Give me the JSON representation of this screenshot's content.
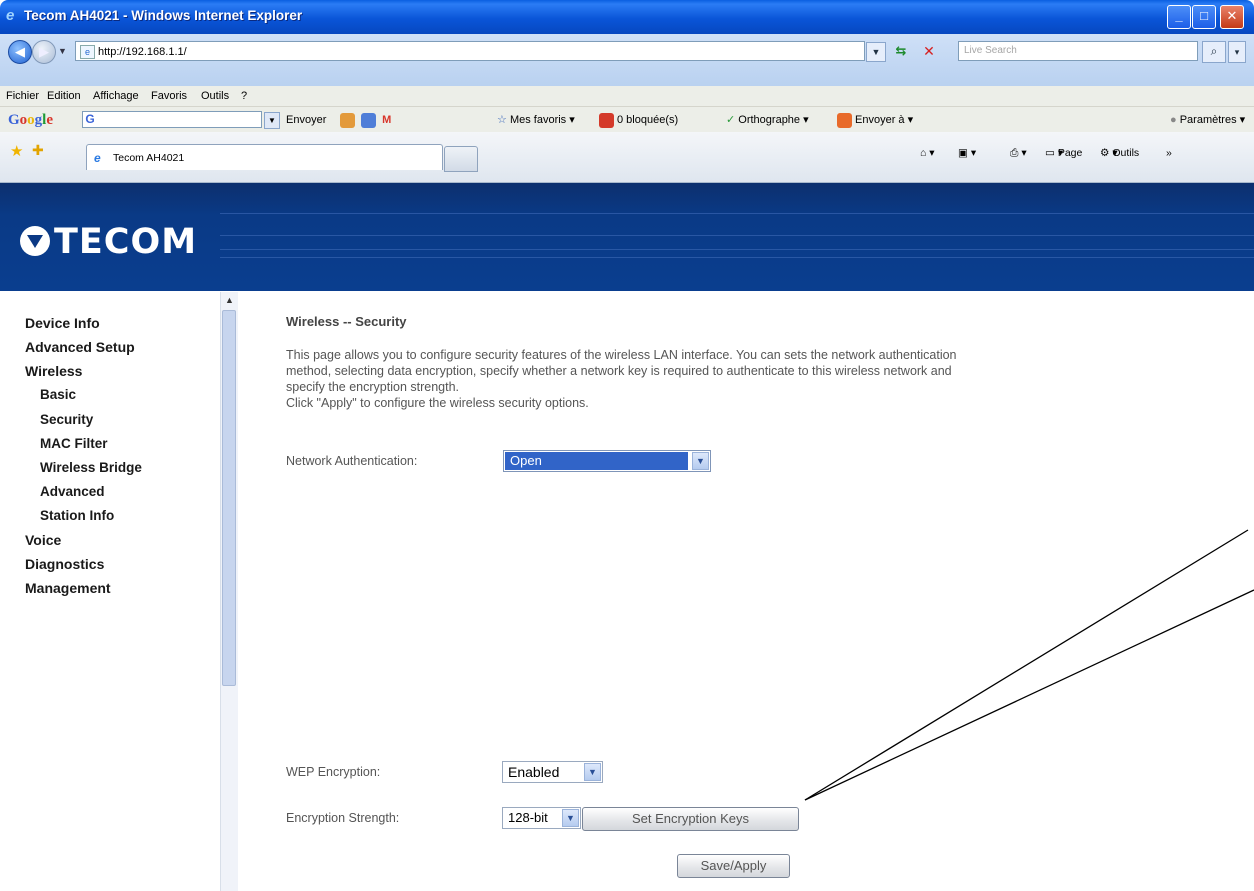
{
  "window": {
    "title": "Tecom AH4021 - Windows Internet Explorer",
    "min_glyph": "_",
    "max_glyph": "□",
    "close_glyph": "✕"
  },
  "address": {
    "url": "http://192.168.1.1/",
    "search_placeholder": "Live Search"
  },
  "menu": [
    "Fichier",
    "Edition",
    "Affichage",
    "Favoris",
    "Outils",
    "?"
  ],
  "google_toolbar": {
    "logo": [
      "G",
      "o",
      "o",
      "g",
      "l",
      "e"
    ],
    "envoyer": "Envoyer",
    "mes_favoris": "Mes favoris",
    "bloquees": "0 bloquée(s)",
    "orthographe": "Orthographe",
    "envoyer_a": "Envoyer à",
    "parametres": "Paramètres"
  },
  "tabs": {
    "active_label": "Tecom AH4021"
  },
  "command_bar": {
    "page": "Page",
    "outils": "Outils"
  },
  "logo_text": "TECOM",
  "sidebar": {
    "items": [
      {
        "label": "Device Info",
        "level": 0
      },
      {
        "label": "Advanced Setup",
        "level": 0
      },
      {
        "label": "Wireless",
        "level": 0
      },
      {
        "label": "Basic",
        "level": 1
      },
      {
        "label": "Security",
        "level": 1
      },
      {
        "label": "MAC Filter",
        "level": 1
      },
      {
        "label": "Wireless Bridge",
        "level": 1
      },
      {
        "label": "Advanced",
        "level": 1
      },
      {
        "label": "Station Info",
        "level": 1
      },
      {
        "label": "Voice",
        "level": 0
      },
      {
        "label": "Diagnostics",
        "level": 0
      },
      {
        "label": "Management",
        "level": 0
      }
    ]
  },
  "main": {
    "title": "Wireless -- Security",
    "description_lines": [
      "This page allows you to configure security features of the wireless LAN interface. You can sets the network authentication",
      "method, selecting data encryption, specify whether a network key is required to authenticate to this wireless network and",
      "specify the encryption strength.",
      "Click \"Apply\" to configure the wireless security options."
    ],
    "network_auth_label": "Network Authentication:",
    "network_auth_value": "Open",
    "wep_label": "WEP Encryption:",
    "wep_value": "Enabled",
    "strength_label": "Encryption Strength:",
    "strength_value": "128-bit",
    "set_keys_button": "Set Encryption Keys",
    "save_button": "Save/Apply"
  },
  "colors": {
    "banner": "#0a3a86",
    "selection": "#3164c8",
    "title_bar": "#0a55d8"
  }
}
